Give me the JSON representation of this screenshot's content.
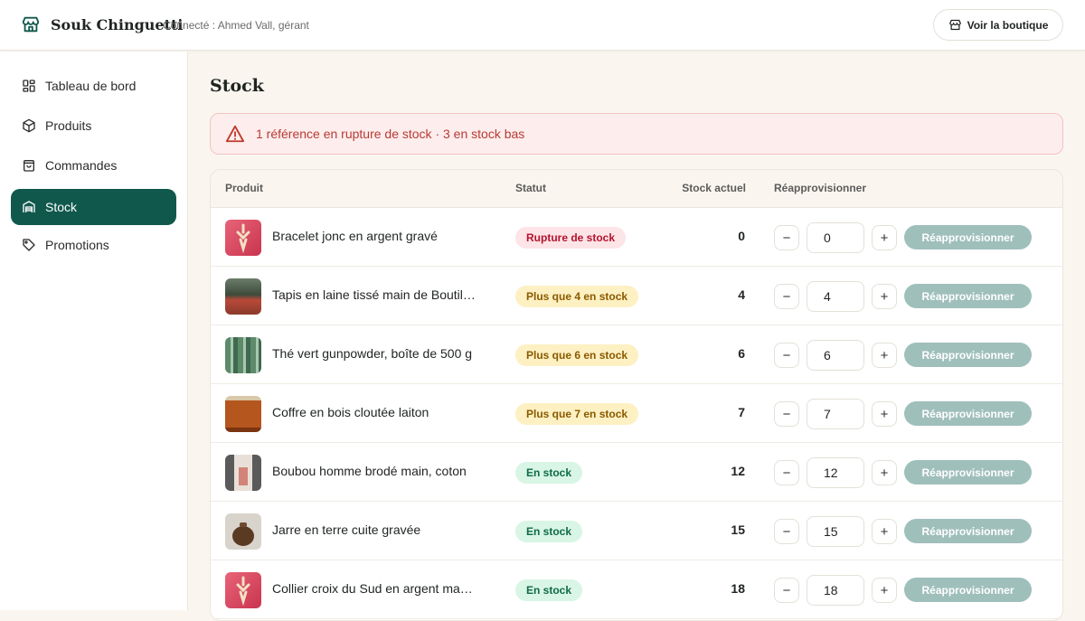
{
  "header": {
    "brand": "Souk Chinguetti",
    "connected": "Connecté : Ahmed Vall, gérant",
    "shop_button": "Voir la boutique",
    "brand_icon": "storefront-icon"
  },
  "sidebar": {
    "items": [
      {
        "label": "Tableau de bord",
        "icon": "dashboard-icon",
        "active": false
      },
      {
        "label": "Produits",
        "icon": "package-icon",
        "active": false
      },
      {
        "label": "Commandes",
        "icon": "shopping-bag-icon",
        "active": false
      },
      {
        "label": "Stock",
        "icon": "warehouse-icon",
        "active": true
      },
      {
        "label": "Promotions",
        "icon": "tag-icon",
        "active": false
      }
    ]
  },
  "page": {
    "title": "Stock",
    "alert": "1 référence en rupture de stock · 3 en stock bas"
  },
  "table": {
    "columns": {
      "product": "Produit",
      "status": "Statut",
      "stock": "Stock actuel",
      "restock": "Réapprovisionner"
    },
    "minus": "−",
    "plus": "+",
    "rows": [
      {
        "name": "Bracelet jonc en argent gravé",
        "status": "Rupture de stock",
        "status_type": "red",
        "stock": "0",
        "qty": "0",
        "action": "Réapprovisionner"
      },
      {
        "name": "Tapis en laine tissé main de Boutilimit",
        "status": "Plus que 4 en stock",
        "status_type": "yellow",
        "stock": "4",
        "qty": "4",
        "action": "Réapprovisionner"
      },
      {
        "name": "Thé vert gunpowder, boîte de 500 g",
        "status": "Plus que 6 en stock",
        "status_type": "yellow",
        "stock": "6",
        "qty": "6",
        "action": "Réapprovisionner"
      },
      {
        "name": "Coffre en bois cloutée laiton",
        "status": "Plus que 7 en stock",
        "status_type": "yellow",
        "stock": "7",
        "qty": "7",
        "action": "Réapprovisionner"
      },
      {
        "name": "Boubou homme brodé main, coton",
        "status": "En stock",
        "status_type": "green",
        "stock": "12",
        "qty": "12",
        "action": "Réapprovisionner"
      },
      {
        "name": "Jarre en terre cuite gravée",
        "status": "En stock",
        "status_type": "green",
        "stock": "15",
        "qty": "15",
        "action": "Réapprovisionner"
      },
      {
        "name": "Collier croix du Sud en argent massif",
        "status": "En stock",
        "status_type": "green",
        "stock": "18",
        "qty": "18",
        "action": "Réapprovisionner"
      }
    ]
  },
  "colors": {
    "accent": "#10584c",
    "alert_bg": "#fdeded",
    "alert_text": "#b83a32",
    "badge_red": "#fde4e6",
    "badge_yellow": "#fdf0c2",
    "badge_green": "#d9f5e6",
    "restock_button": "#9fbfbb"
  }
}
